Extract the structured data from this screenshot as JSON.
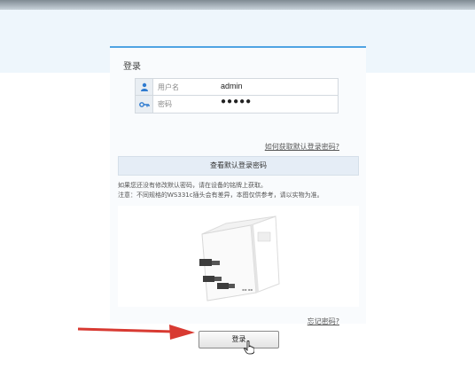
{
  "login": {
    "title": "登录",
    "username": {
      "label": "用户名",
      "value": "admin"
    },
    "password": {
      "label": "密码",
      "value": "●●●●●"
    },
    "help_link": "如何获取默认登录密码?",
    "show_default_button": "查看默认登录密码",
    "notice_line1": "如果您还没有修改默认密码，请在设备的铭牌上获取。",
    "notice_line2": "注意：不同规格的WS331c插头会有差异，本图仅供参考，请以实物为准。",
    "forgot_link": "忘记密码?",
    "submit_label": "登录"
  },
  "icons": {
    "user": "user-icon",
    "key": "key-icon",
    "arrow": "red-arrow-annotation",
    "cursor": "hand-cursor-icon"
  },
  "colors": {
    "accent": "#4fa3e3",
    "arrow": "#d83a32"
  }
}
